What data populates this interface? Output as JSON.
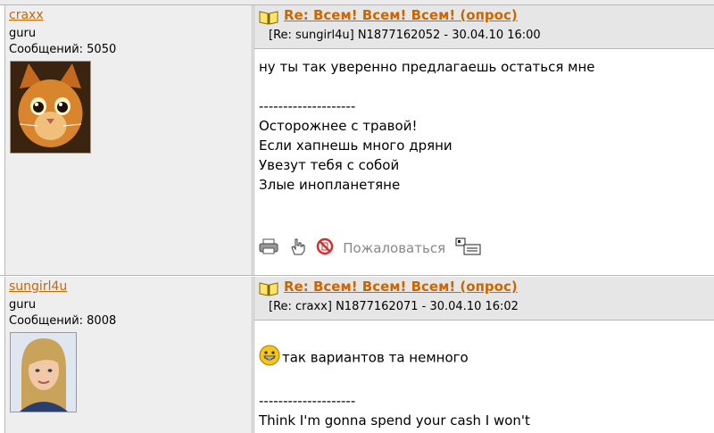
{
  "posts": [
    {
      "username": "craxx",
      "rank": "guru",
      "messages": "Сообщений: 5050",
      "avatar": "cat-avatar",
      "title": "Re: Всем! Всем! Всем! (опрос)",
      "meta": "[Re: sungirl4u]  N1877162052 - 30.04.10 16:00",
      "lines": [
        "ну ты так уверенно предлагаешь остаться мне",
        "",
        "--------------------",
        "Осторожнее с травой!",
        "Если хапнешь много дряни",
        "Увезут тебя с собой",
        "Злые инопланетяне"
      ],
      "tools": {
        "print_icon": "printer-icon",
        "reply_icon": "hand-point-icon",
        "block_icon": "forbidden-icon",
        "report_label": "Пожаловаться",
        "tree_icon": "tree-view-icon"
      }
    },
    {
      "username": "sungirl4u",
      "rank": "guru",
      "messages": "Сообщений: 8008",
      "avatar": "woman-avatar",
      "title": "Re: Всем! Всем! Всем! (опрос)",
      "meta": "[Re: craxx]  N1877162071 - 30.04.10 16:02",
      "smiley": "grin-smiley-icon",
      "lines": [
        "так вариантов та немного",
        "",
        "--------------------",
        "Think I'm gonna spend your cash I won't"
      ]
    }
  ],
  "colors": {
    "link": "#cc6600",
    "author_bg": "#eeeeee",
    "header_bg": "#e6e6e6",
    "border": "#b8b8b8"
  }
}
